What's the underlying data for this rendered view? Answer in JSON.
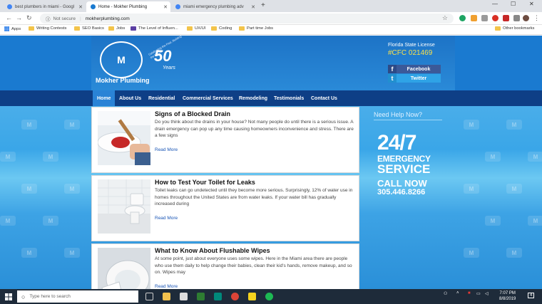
{
  "browser": {
    "tabs": [
      {
        "label": "best plumbers in miami - Googl",
        "active": false
      },
      {
        "label": "Home - Mokher Plumbing",
        "active": true
      },
      {
        "label": "miami emergency plumbing adv",
        "active": false
      }
    ],
    "address": {
      "security": "Not secure",
      "url": "mokherplumbing.com"
    },
    "bookmarks": [
      "Apps",
      "Writing Contests",
      "SEO Basics",
      "Jobs",
      "The Level of Influen...",
      "UX/UI",
      "Coding",
      "Part time Jobs",
      "Other bookmarks"
    ]
  },
  "site": {
    "logo_text": "M",
    "brand": "Mokher Plumbing",
    "anniversary": {
      "number": "50",
      "years": "Years",
      "arc": "Celebrating the Past, Building the Future"
    },
    "license_label": "Florida State License",
    "license_number": "#CFC 021469",
    "social": [
      {
        "icon": "f",
        "label": "Facebook",
        "color": "#3b5998"
      },
      {
        "icon": "t",
        "label": "Twitter",
        "color": "#2fa3e6"
      }
    ],
    "nav": [
      "Home",
      "About Us",
      "Residential",
      "Commercial Services",
      "Remodeling",
      "Testimonials",
      "Contact Us"
    ],
    "posts": [
      {
        "title": "Signs of a Blocked Drain",
        "body": "Do you think about the drains in your house? Not many people do until there is a serious issue. A drain emergency can pop up any time causing homeowners inconvenience and stress. There are a few signs",
        "link": "Read More"
      },
      {
        "title": "How to Test Your Toilet for Leaks",
        "body": "Toilet leaks can go undetected until they become more serious. Surprisingly, 12% of water use in homes throughout the United States are from water leaks. If your water bill has gradually increased during",
        "link": "Read More"
      },
      {
        "title": "What to Know About Flushable Wipes",
        "body": "At some point, just about everyone uses some wipes. Here in the Miami area there are people who use them daily to help change their babies, clean their kid's hands, remove makeup, and so on. Wipes may",
        "link": "Read More"
      }
    ],
    "sidebar": {
      "help": "Need Help Now?",
      "big": "24/7",
      "line1": "EMERGENCY",
      "line2": "SERVICE",
      "call": "CALL NOW",
      "phone": "305.446.8266"
    },
    "watermark": "M"
  },
  "taskbar": {
    "search_placeholder": "Type here to search",
    "time": "7:07 PM",
    "date": "8/8/2019",
    "notifications": "4"
  },
  "colors": {
    "nav": "#0e3f86",
    "accent": "#2a83d6",
    "license": "#f9e14b"
  }
}
